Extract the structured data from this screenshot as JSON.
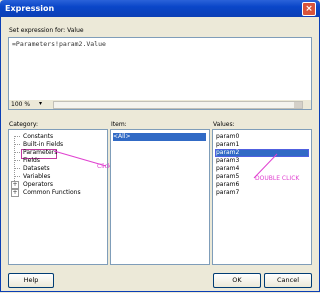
{
  "window": {
    "title": "Expression"
  },
  "expression": {
    "label": "Set expression for: Value",
    "value": "=Parameters!param2.Value",
    "zoom": "100 %"
  },
  "category": {
    "label": "Category:",
    "items": [
      "Constants",
      "Built-in Fields",
      "Parameters",
      "Fields",
      "Datasets",
      "Variables",
      "Operators",
      "Common Functions"
    ],
    "selected": "Parameters"
  },
  "item": {
    "label": "Item:",
    "items": [
      "<All>"
    ],
    "selected": "<All>"
  },
  "values": {
    "label": "Values:",
    "items": [
      "param0",
      "param1",
      "param2",
      "param3",
      "param4",
      "param5",
      "param6",
      "param7"
    ],
    "selected": "param2"
  },
  "annotations": {
    "click": "Click",
    "double_click": "DOUBLE CLICK"
  },
  "buttons": {
    "help": "Help",
    "ok": "OK",
    "cancel": "Cancel"
  },
  "colors": {
    "title_bar": "#0b3fb5",
    "selection": "#316ac5",
    "annotation": "#e040d0"
  }
}
